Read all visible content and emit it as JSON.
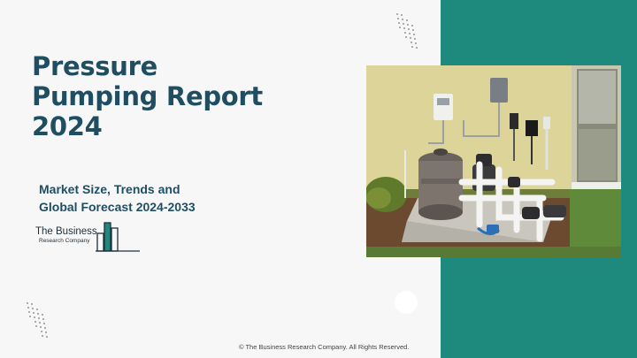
{
  "title_lines": [
    "Pressure",
    "Pumping Report",
    "2024"
  ],
  "subtitle_lines": [
    "Market Size, Trends and",
    "Global Forecast 2024-2033"
  ],
  "logo": {
    "line1": "The Business",
    "line2": "Research Company"
  },
  "footer": {
    "copyright": "© The Business Research Company. All Rights Reserved."
  },
  "colors": {
    "accent_teal": "#1e8a7e",
    "title_navy": "#1f4e63",
    "background": "#f7f7f7"
  },
  "photo": {
    "icon": "pool-pump-equipment-photo"
  }
}
